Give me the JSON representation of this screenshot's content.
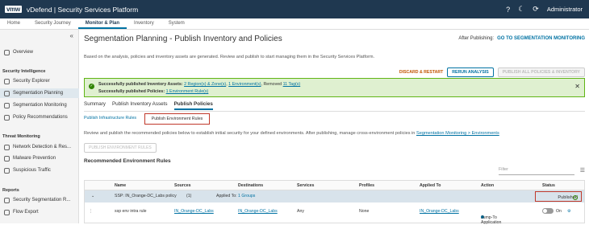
{
  "topbar": {
    "logo": "vmw",
    "title": "vDefend | Security Services Platform",
    "user": "Administrator"
  },
  "nav": {
    "tabs": [
      "Home",
      "Security Journey",
      "Monitor & Plan",
      "Inventory",
      "System"
    ]
  },
  "sidebar": {
    "collapse": "«",
    "overview": "Overview",
    "sec1": "Security Intelligence",
    "items1": [
      "Security Explorer",
      "Segmentation Planning",
      "Segmentation Monitoring",
      "Policy Recommendations"
    ],
    "sec2": "Threat Monitoring",
    "items2": [
      "Network Detection & Res...",
      "Malware Prevention",
      "Suspicious Traffic"
    ],
    "sec3": "Reports",
    "items3": [
      "Security Segmentation R...",
      "Flow Export"
    ]
  },
  "main": {
    "title": "Segmentation Planning - Publish Inventory and Policies",
    "after_label": "After Publishing:",
    "after_link": "GO TO SEGMENTATION MONITORING",
    "desc": "Based on the analysis, policies and inventory assets are generated. Review and publish to start managing them in the Security Services Platform.",
    "discard": "DISCARD & RESTART",
    "rerun": "RERUN ANALYSIS",
    "publish_all": "PUBLISH ALL POLICIES & INVENTORY"
  },
  "alert": {
    "l1_prefix": "Successfully published Inventory Assets:",
    "l1_link1": "2 Region(s) & Zone(s)",
    "l1_link2": "1 Environment(s)",
    "l1_mid": "Removed",
    "l1_link3": "11 Tag(s)",
    "l2_prefix": "Successfully published Policies:",
    "l2_link": "1 Environment Rule(s)"
  },
  "tabs": [
    "Summary",
    "Publish Inventory Assets",
    "Publish Policies"
  ],
  "subtabs": {
    "infra": "Publish Infrastructure Rules",
    "env": "Publish Environment Rules"
  },
  "desc2": {
    "text": "Review and publish the recommended policies below to establish initial security for your defined environments. After publishing, manage cross-environment policies in",
    "link": "Segmentation Monitoring > Environments"
  },
  "publish_env_btn": "PUBLISH ENVIRONMENT RULES",
  "rules_title": "Recommended Environment Rules",
  "filter_placeholder": "Filter",
  "table": {
    "headers": [
      "Name",
      "Sources",
      "Destinations",
      "Services",
      "Profiles",
      "Applied To",
      "Action",
      "Status"
    ],
    "group": {
      "name": "SSP: IN_Orange-DC_Labs policy",
      "count": "(1)",
      "applied_label": "Applied To:",
      "applied_value": "1 Groups",
      "status": "Published"
    },
    "row": {
      "name": "ssp env intra rule",
      "source": "IN_Orange-DC_Labs",
      "destination": "IN_Orange-DC_Labs",
      "service": "Any",
      "profile": "None",
      "applied": "IN_Orange-DC_Labs",
      "action": "Jump-To Application",
      "toggle": "On"
    }
  }
}
